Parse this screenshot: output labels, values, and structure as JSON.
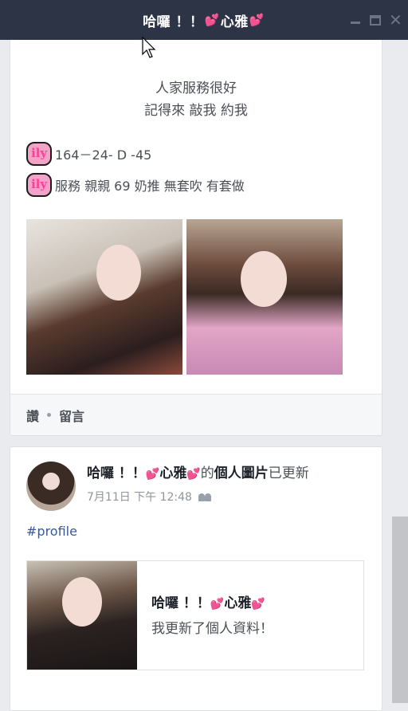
{
  "titlebar": {
    "title_prefix": "哈囉 ！！",
    "title_name": "心雅",
    "heart": "💕",
    "controls": [
      "minimize",
      "maximize",
      "close"
    ]
  },
  "post1": {
    "text_line1": "人家服務很好",
    "text_line2": "記得來 敲我 約我",
    "badge_text": "ily",
    "stats_line": "164－24-  D -45",
    "service_line": "服務 親親 69 奶推 無套吹 有套做",
    "actions": {
      "like": "讚",
      "comment": "留言"
    }
  },
  "post2": {
    "author_prefix": "哈囉 ！！",
    "author_name": "心雅",
    "heart": "💕",
    "suffix_pre": "的",
    "suffix_bold": "個人圖片",
    "suffix_post": "已更新",
    "timestamp": "7月11日 下午 12:48",
    "hashtag": "#profile",
    "share": {
      "title_prefix": "哈囉 ！！",
      "title_name": "心雅",
      "description": "我更新了個人資料！"
    }
  },
  "icons": {
    "audience": "friends-icon",
    "cursor": "mouse-pointer-icon"
  },
  "colors": {
    "titlebar_bg": "#2d3446",
    "heart": "#ff4fb8",
    "link": "#385898"
  }
}
